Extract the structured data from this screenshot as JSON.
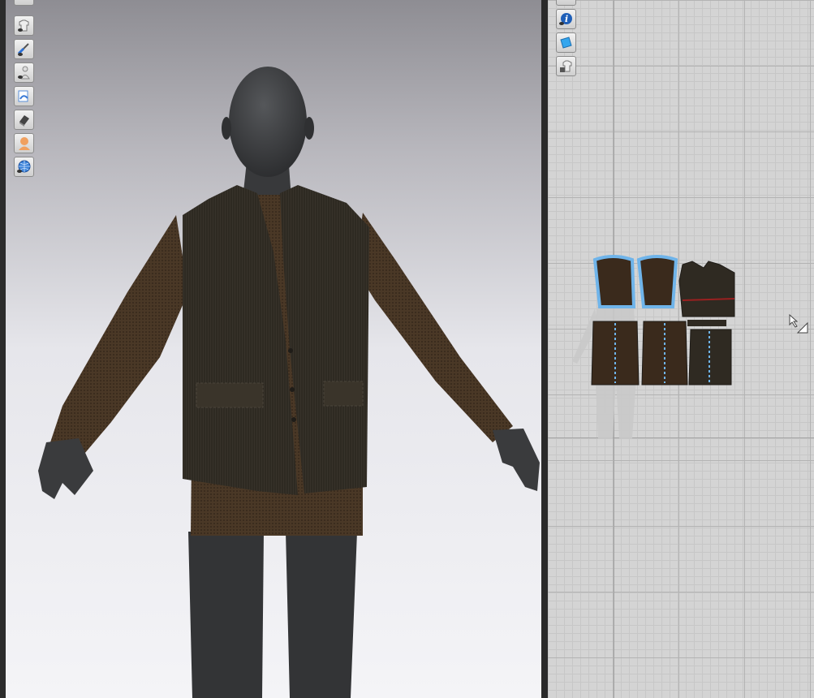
{
  "viewport3d": {
    "toolbar": [
      {
        "name": "show-garment-icon"
      },
      {
        "name": "show-avatar-brush-icon"
      },
      {
        "name": "show-avatar-icon"
      },
      {
        "name": "texture-view-icon"
      },
      {
        "name": "hide-3d-garment-icon"
      },
      {
        "name": "skin-avatar-icon"
      },
      {
        "name": "globe-environment-icon"
      }
    ]
  },
  "viewport2d": {
    "toolbar": [
      {
        "name": "info-icon"
      },
      {
        "name": "pattern-texture-icon"
      },
      {
        "name": "lock-garment-icon"
      }
    ]
  },
  "colors": {
    "fabric_dark": "#2f2a22",
    "fabric_brown": "#4a3826",
    "selection_blue": "#6fb4ea",
    "avatar": "#3a3b3d"
  }
}
